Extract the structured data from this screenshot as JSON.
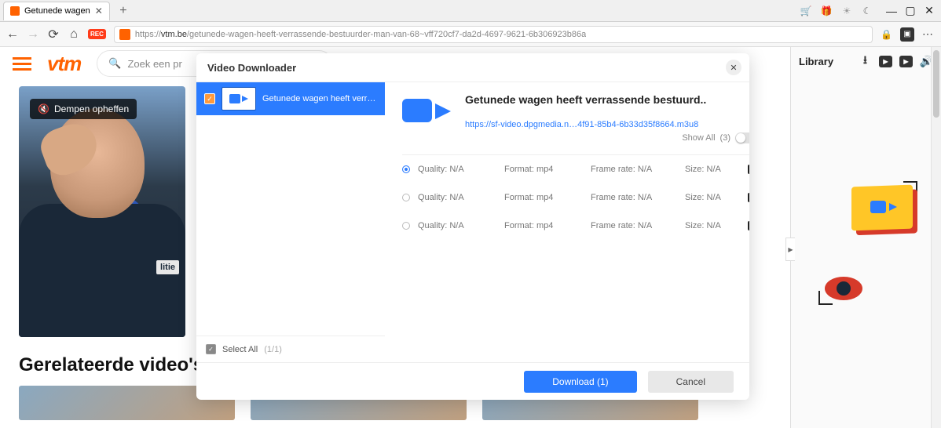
{
  "tabbar": {
    "title": "Getunede wagen",
    "right_icons": [
      "cart",
      "gift",
      "sun",
      "moon"
    ]
  },
  "urlbar": {
    "url_domain": "vtm.be",
    "url_path": "/getunede-wagen-heeft-verrassende-bestuurder-man-van-68~vff720cf7-da2d-4697-9621-6b306923b86a",
    "rec": "REC"
  },
  "page": {
    "logo": "vtm",
    "search_placeholder": "Zoek een pr",
    "mute_label": "Dempen opheffen",
    "politie_patch": "litie",
    "related_heading": "Gerelateerde video's"
  },
  "downloader": {
    "title": "Video Downloader",
    "list_item_title": "Getunede wagen heeft verrassen...",
    "select_all_label": "Select All",
    "select_all_count": "(1/1)",
    "detail_title": "Getunede wagen heeft verrassende bestuurd..",
    "detail_url": "https://sf-video.dpgmedia.n…4f91-85b4-6b33d35f8664.m3u8",
    "show_all_label": "Show All",
    "show_all_count": "(3)",
    "formats": [
      {
        "selected": true,
        "quality": "Quality: N/A",
        "format": "Format: mp4",
        "framerate": "Frame rate: N/A",
        "size": "Size: N/A"
      },
      {
        "selected": false,
        "quality": "Quality: N/A",
        "format": "Format: mp4",
        "framerate": "Frame rate: N/A",
        "size": "Size: N/A"
      },
      {
        "selected": false,
        "quality": "Quality: N/A",
        "format": "Format: mp4",
        "framerate": "Frame rate: N/A",
        "size": "Size: N/A"
      }
    ],
    "download_label": "Download (1)",
    "cancel_label": "Cancel"
  },
  "library": {
    "title": "Library"
  }
}
